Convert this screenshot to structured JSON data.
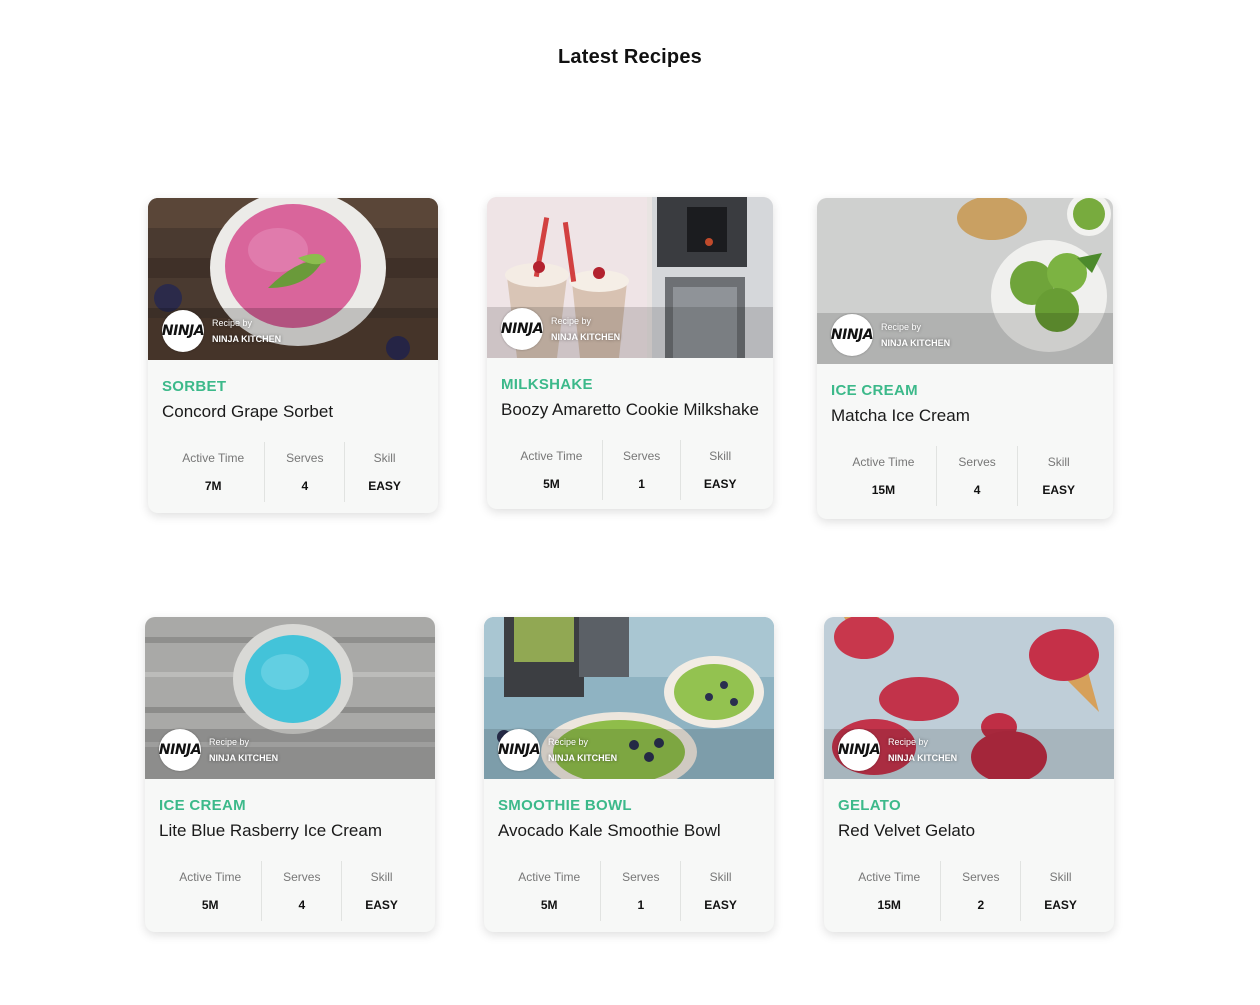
{
  "page": {
    "title": "Latest Recipes"
  },
  "labels": {
    "active_time": "Active Time",
    "serves": "Serves",
    "skill": "Skill",
    "recipe_by": "Recipe by",
    "ninja_kitchen": "NINJA KITCHEN",
    "logo": "NINJA"
  },
  "recipes": [
    {
      "category": "SORBET",
      "title": "Concord Grape Sorbet",
      "active_time": "7M",
      "serves": "4",
      "skill": "EASY"
    },
    {
      "category": "MILKSHAKE",
      "title": "Boozy Amaretto Cookie Milkshake",
      "active_time": "5M",
      "serves": "1",
      "skill": "EASY"
    },
    {
      "category": "ICE CREAM",
      "title": "Matcha Ice Cream",
      "active_time": "15M",
      "serves": "4",
      "skill": "EASY"
    },
    {
      "category": "ICE CREAM",
      "title": "Lite Blue Rasberry Ice Cream",
      "active_time": "5M",
      "serves": "4",
      "skill": "EASY"
    },
    {
      "category": "SMOOTHIE BOWL",
      "title": "Avocado Kale Smoothie Bowl",
      "active_time": "5M",
      "serves": "1",
      "skill": "EASY"
    },
    {
      "category": "GELATO",
      "title": "Red Velvet Gelato",
      "active_time": "15M",
      "serves": "2",
      "skill": "EASY"
    }
  ],
  "colors": {
    "category": "#3cb98a",
    "card_bg": "#f7f8f7"
  }
}
